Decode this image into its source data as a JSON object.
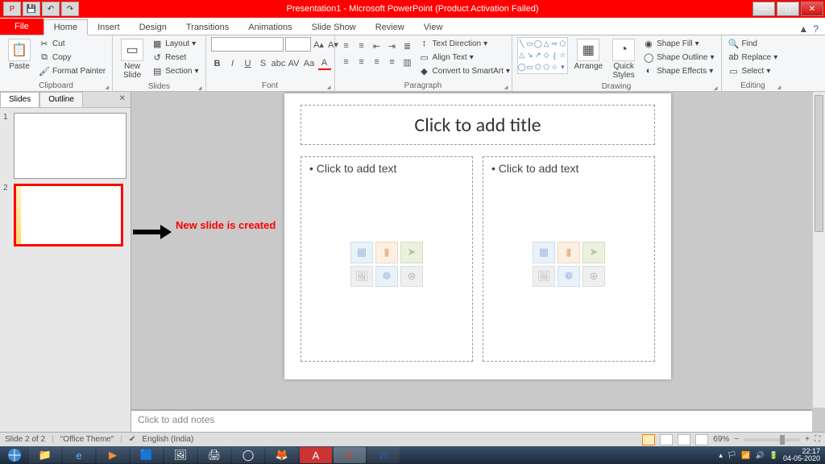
{
  "titlebar": {
    "title": "Presentation1 - Microsoft PowerPoint (Product Activation Failed)"
  },
  "ribbon": {
    "file": "File",
    "tabs": [
      "Home",
      "Insert",
      "Design",
      "Transitions",
      "Animations",
      "Slide Show",
      "Review",
      "View"
    ],
    "active_tab": "Home",
    "clipboard": {
      "paste": "Paste",
      "cut": "Cut",
      "copy": "Copy",
      "format_painter": "Format Painter",
      "label": "Clipboard"
    },
    "slides": {
      "new_slide": "New\nSlide",
      "layout": "Layout",
      "reset": "Reset",
      "section": "Section",
      "label": "Slides"
    },
    "font": {
      "label": "Font"
    },
    "paragraph": {
      "text_direction": "Text Direction",
      "align_text": "Align Text",
      "convert_smartart": "Convert to SmartArt",
      "label": "Paragraph"
    },
    "drawing": {
      "arrange": "Arrange",
      "quick_styles": "Quick\nStyles",
      "shape_fill": "Shape Fill",
      "shape_outline": "Shape Outline",
      "shape_effects": "Shape Effects",
      "label": "Drawing"
    },
    "editing": {
      "find": "Find",
      "replace": "Replace",
      "select": "Select",
      "label": "Editing"
    }
  },
  "slidespane": {
    "tab_slides": "Slides",
    "tab_outline": "Outline",
    "slide1_num": "1",
    "slide2_num": "2"
  },
  "annotation": "New slide is created",
  "slide": {
    "title_placeholder": "Click to add title",
    "body_placeholder": "Click to add text"
  },
  "notes": "Click to add notes",
  "status": {
    "slide_info": "Slide 2 of 2",
    "theme": "\"Office Theme\"",
    "language": "English (India)",
    "zoom": "69%"
  },
  "taskbar": {
    "time": "22:17",
    "date": "04-05-2020"
  }
}
